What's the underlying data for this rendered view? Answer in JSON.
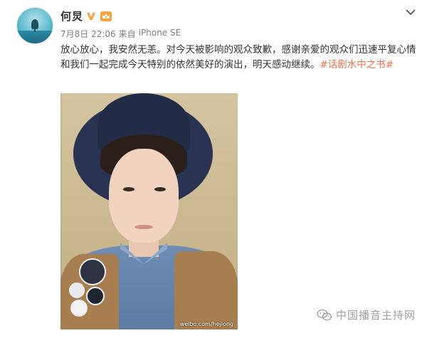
{
  "user": {
    "name": "何炅"
  },
  "post": {
    "date": "7月8日 22:06",
    "source_prefix": "来自",
    "source": "iPhone SE",
    "text": "放心放心，我安然无恙。对今天被影响的观众致歉，感谢亲爱的观众们迅速平复心情和我们一起完成今天特别的依然美好的演出，明天感动继续。",
    "hashtag": "#话剧水中之书#"
  },
  "photo": {
    "watermark": "weibo.com/hejiong"
  },
  "footer": {
    "site_name": "中国播音主持网"
  },
  "colors": {
    "accent": "#eb7350",
    "meta": "#808080",
    "text": "#333333",
    "verified": "#f7a23b"
  },
  "icons": {
    "verified": "verified-v-icon",
    "member": "member-crown-icon",
    "menu": "chevron-down-icon",
    "wechat": "wechat-icon"
  }
}
